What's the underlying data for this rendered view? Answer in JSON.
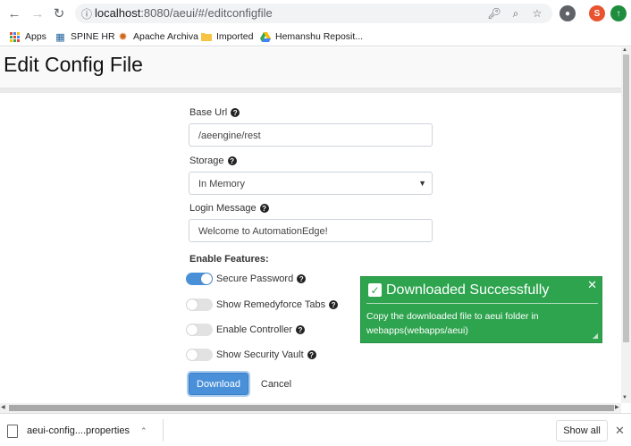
{
  "browser": {
    "url_host": "localhost",
    "url_rest": ":8080/aeui/#/editconfigfile",
    "profile_initial": "S",
    "bookmarks": [
      {
        "label": "Apps"
      },
      {
        "label": "SPINE HR"
      },
      {
        "label": "Apache Archiva"
      },
      {
        "label": "Imported"
      },
      {
        "label": "Hemanshu Reposit..."
      }
    ]
  },
  "page": {
    "title": "Edit Config File",
    "base_url": {
      "label": "Base Url",
      "value": "/aeengine/rest"
    },
    "storage": {
      "label": "Storage",
      "value": "In Memory"
    },
    "login_message": {
      "label": "Login Message",
      "value": "Welcome to AutomationEdge!"
    },
    "features_heading": "Enable Features:",
    "features": [
      {
        "label": "Secure Password",
        "enabled": true
      },
      {
        "label": "Show Remedyforce Tabs",
        "enabled": false
      },
      {
        "label": "Enable Controller",
        "enabled": false
      },
      {
        "label": "Show Security Vault",
        "enabled": false
      }
    ],
    "download_label": "Download",
    "cancel_label": "Cancel"
  },
  "toast": {
    "title": "Downloaded Successfully",
    "message": "Copy the downloaded file to aeui folder in webapps(webapps/aeui)",
    "color": "#2ea44f"
  },
  "downloads": {
    "filename": "aeui-config....properties",
    "show_all_label": "Show all"
  },
  "colors": {
    "accent": "#4a90d9",
    "success": "#2ea44f"
  }
}
